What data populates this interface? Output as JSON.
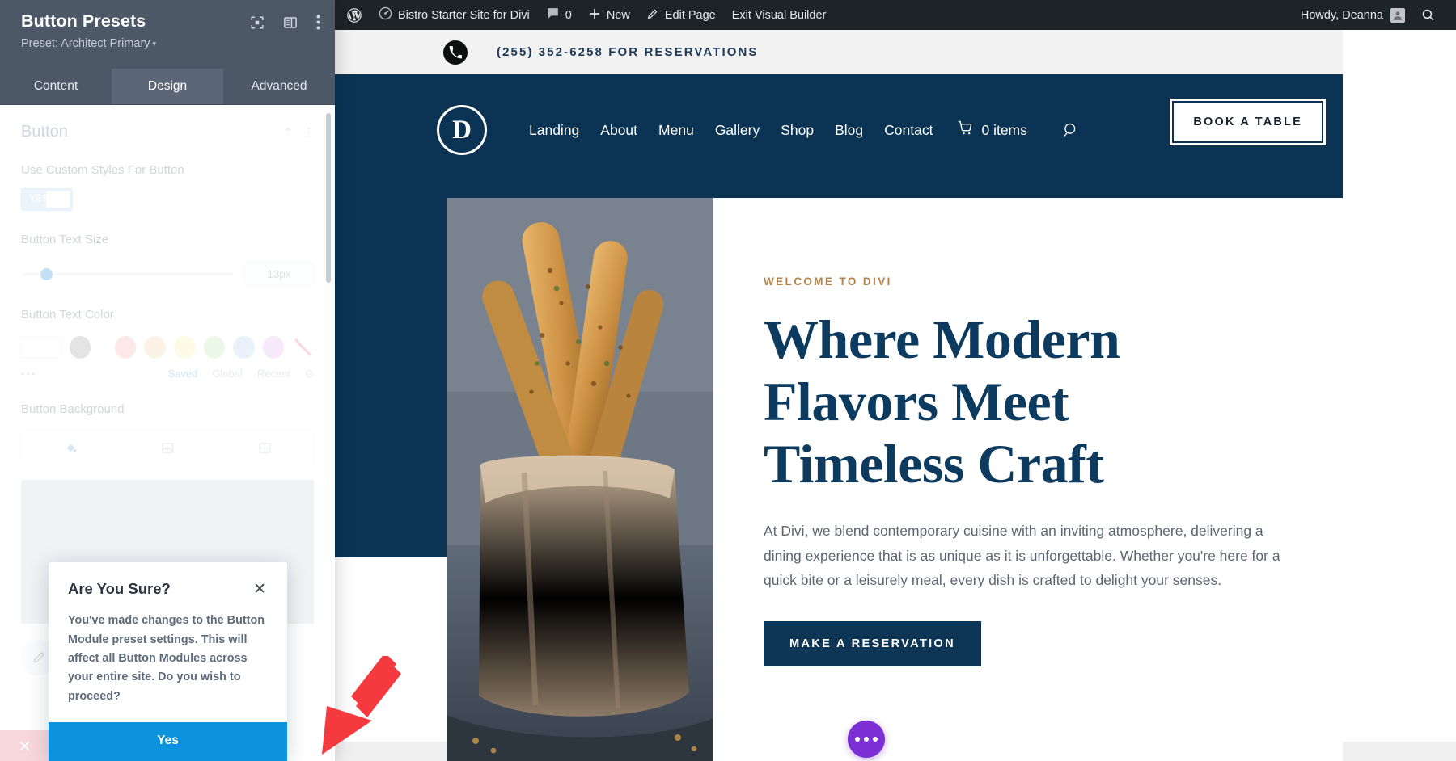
{
  "settings_panel": {
    "title": "Button Presets",
    "preset_label": "Preset: Architect Primary",
    "preset_caret": "▾",
    "tabs": [
      {
        "label": "Content",
        "active": false
      },
      {
        "label": "Design",
        "active": true
      },
      {
        "label": "Advanced",
        "active": false
      }
    ],
    "section": {
      "title": "Button",
      "fields": {
        "use_custom_styles_label": "Use Custom Styles For Button",
        "toggle_value": "YES",
        "text_size_label": "Button Text Size",
        "text_size_value": "13px",
        "text_color_label": "Button Text Color",
        "background_label": "Button Background"
      },
      "color_sources": {
        "saved": "Saved",
        "global": "Global",
        "recent": "Recent",
        "more": "⊙",
        "dots": "•••"
      },
      "swatches": [
        "#a8a8a8",
        "#f8b6b0",
        "#fbd7ad",
        "#fbf0ab",
        "#bfe9b2",
        "#b8d5ef",
        "#e3b9f3"
      ]
    }
  },
  "confirm_dialog": {
    "title": "Are You Sure?",
    "close_icon": "✕",
    "body": "You've made changes to the Button Module preset settings. This will affect all Button Modules across your entire site. Do you wish to proceed?",
    "confirm_label": "Yes",
    "confirm_color": "#0c93de"
  },
  "wp_admin_bar": {
    "wp_logo": "wordpress-logo-icon",
    "site_name": "Bistro Starter Site for Divi",
    "comment_count": "0",
    "new_label": "New",
    "edit_page_label": "Edit Page",
    "exit_builder_label": "Exit Visual Builder",
    "howdy": "Howdy, Deanna",
    "search_icon": "search-icon"
  },
  "site": {
    "topbar": {
      "phone": "(255) 352-6258 FOR RESERVATIONS"
    },
    "nav": {
      "logo_letter": "D",
      "links": [
        "Landing",
        "About",
        "Menu",
        "Gallery",
        "Shop",
        "Blog",
        "Contact"
      ],
      "cart_label": "0 items",
      "cta_label": "BOOK A TABLE"
    },
    "hero": {
      "eyebrow": "WELCOME TO DIVI",
      "heading_line1": "Where Modern",
      "heading_line2": "Flavors Meet",
      "heading_line3": "Timeless Craft",
      "paragraph": "At Divi, we blend contemporary cuisine with an inviting atmosphere, delivering a dining experience that is as unique as it is unforgettable. Whether you're here for a quick bite or a leisurely meal, every dish is crafted to delight your senses.",
      "cta_label": "MAKE A RESERVATION"
    },
    "fab": "more-options-icon"
  },
  "colors": {
    "panel_header": "#4c5866",
    "brand_navy": "#0b3454",
    "accent_gold": "#b5834a",
    "confirm_blue": "#0c93de",
    "fab_purple": "#7b2fd4",
    "arrow_red": "#f43a3f"
  }
}
